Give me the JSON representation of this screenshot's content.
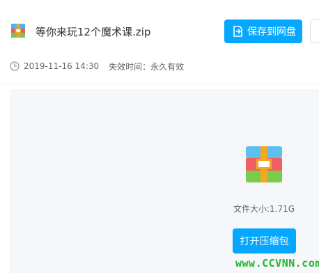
{
  "file": {
    "name": "等你来玩12个魔术课.zip",
    "icon": "zip-archive-icon"
  },
  "actions": {
    "save_label": "保存到网盘",
    "save_icon": "save-to-drive-icon"
  },
  "meta": {
    "date": "2019-11-16 14:30",
    "expiry": "失效时间：永久有效",
    "clock_icon": "clock-icon"
  },
  "preview": {
    "size_text": "文件大小:1.71G",
    "open_label": "打开压缩包"
  },
  "watermark": "www.CCVNN.com",
  "colors": {
    "accent": "#06a7ff",
    "preview_bg": "#f5f7fa",
    "watermark": "#25b72c"
  }
}
